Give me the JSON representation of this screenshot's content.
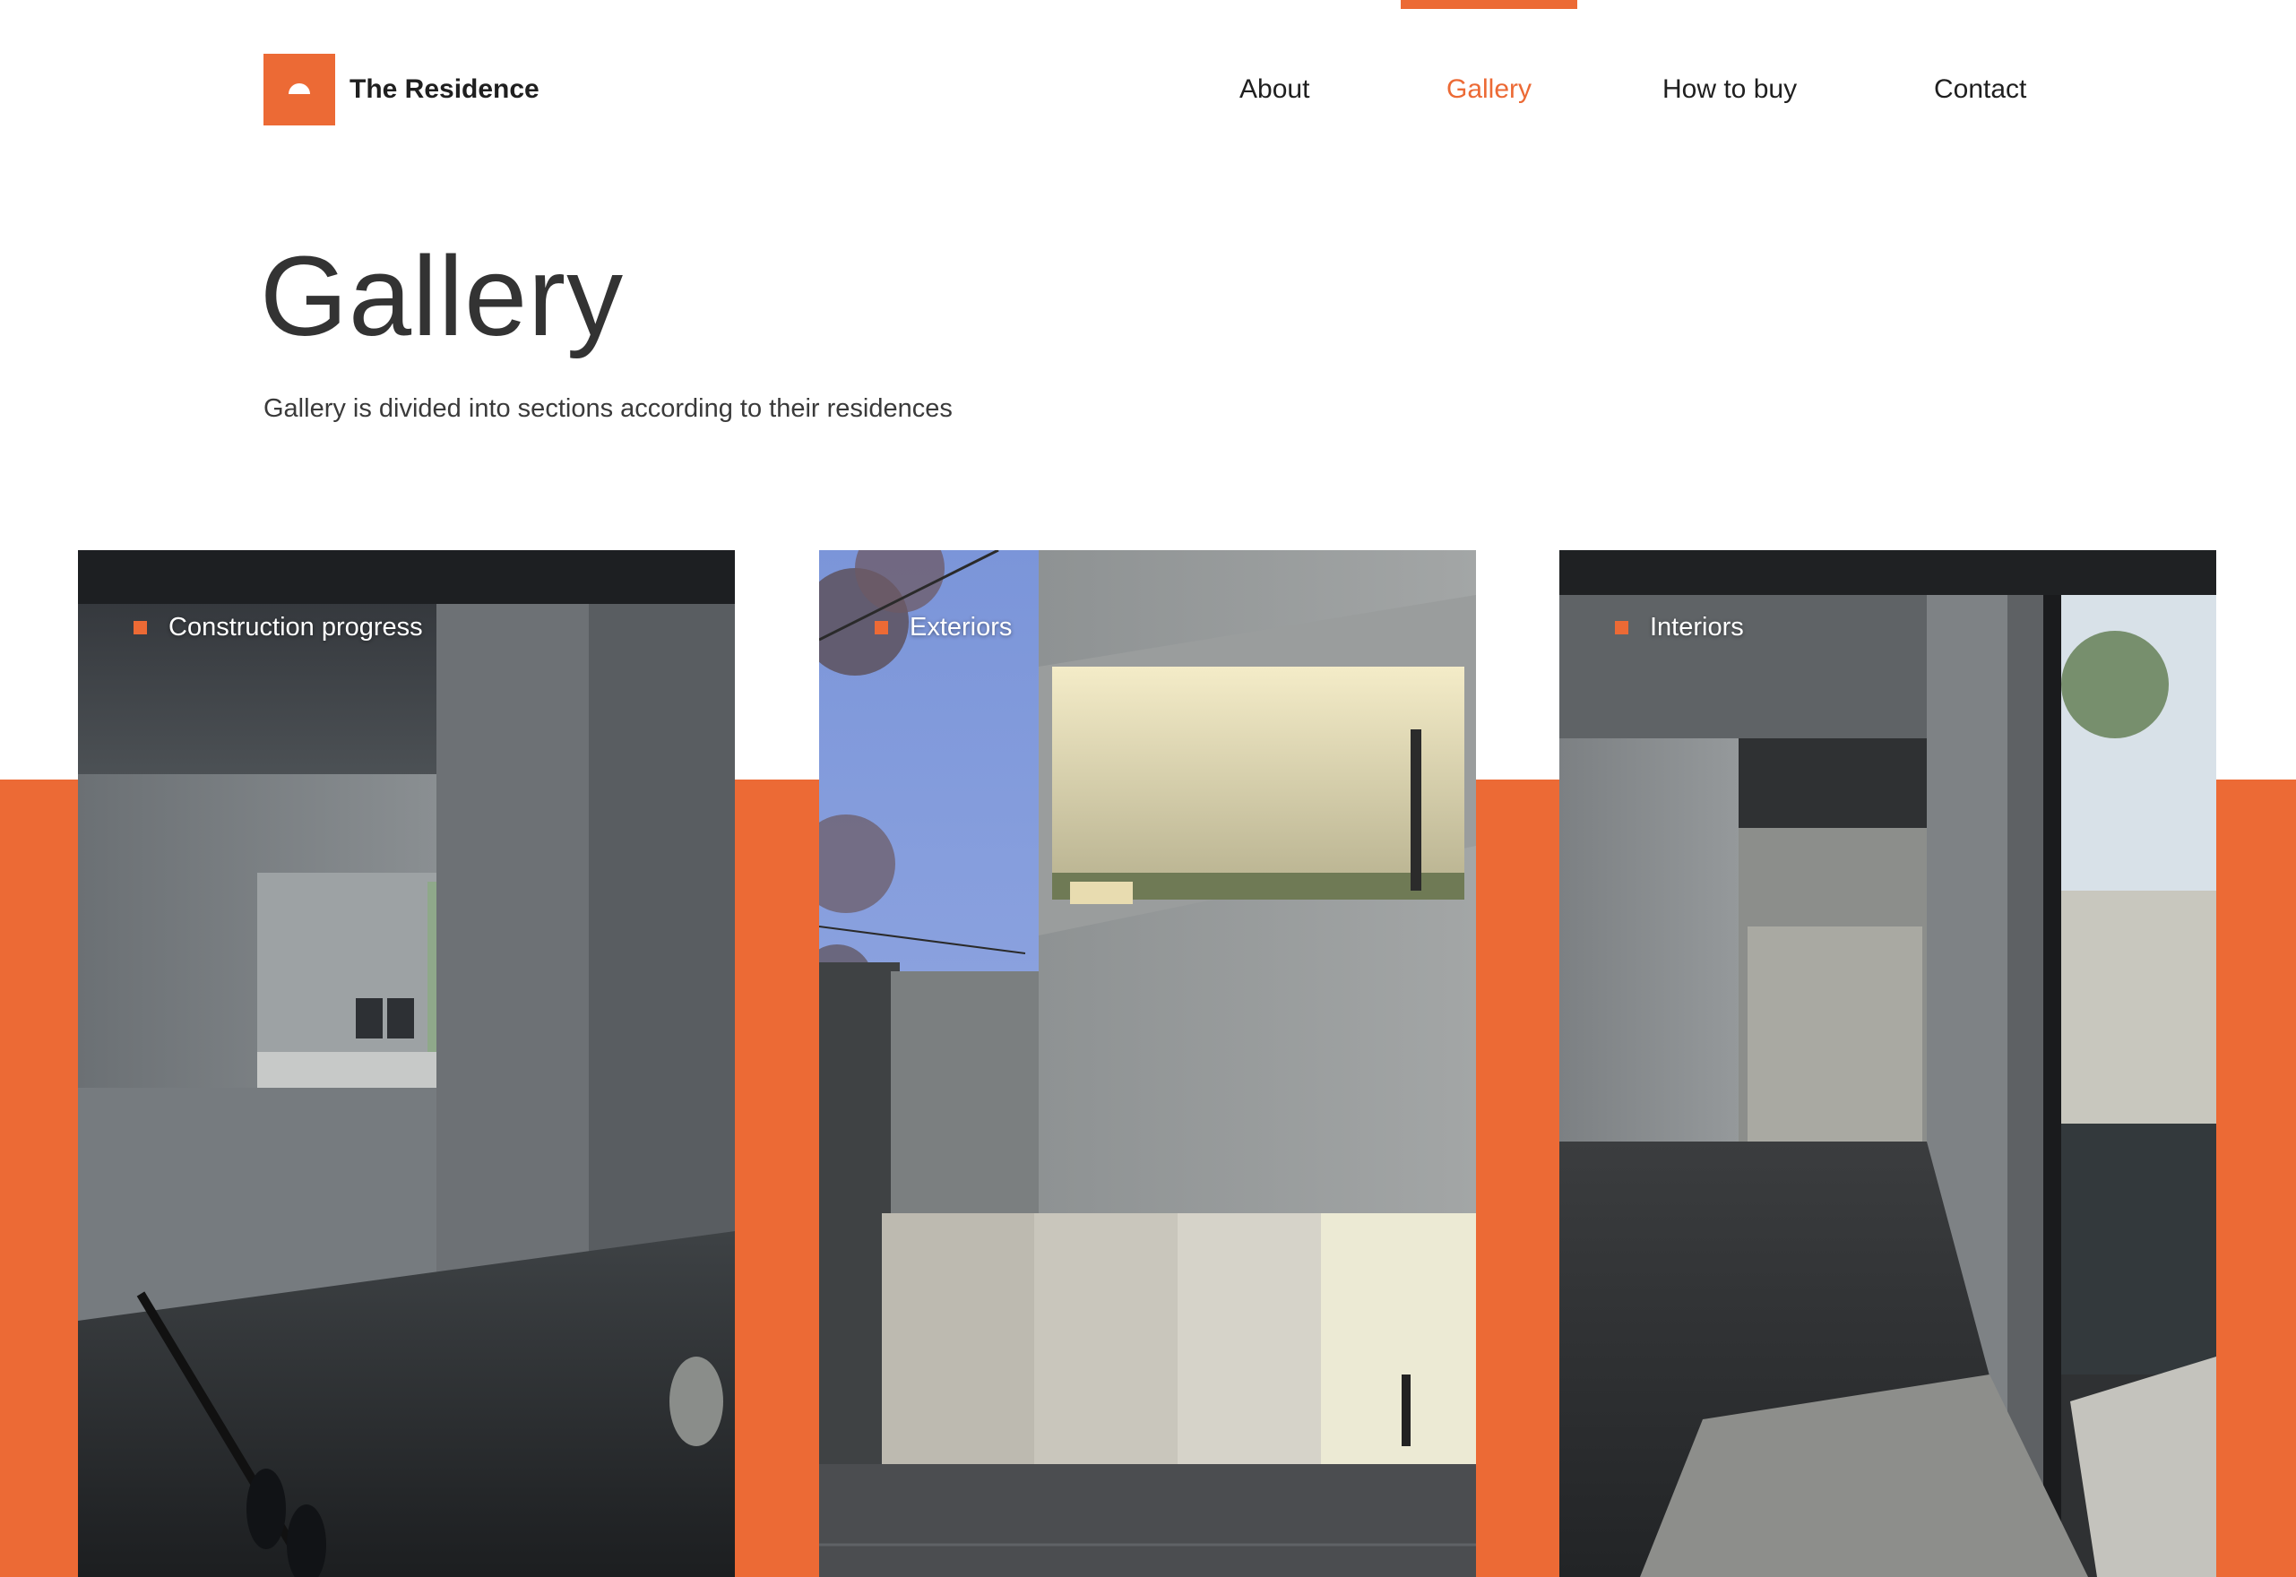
{
  "header": {
    "brand": "The Residence",
    "brand_color": "#ec6a35",
    "logo_icon": "half-sun-icon",
    "nav": [
      {
        "label": "About",
        "active": false
      },
      {
        "label": "Gallery",
        "active": true
      },
      {
        "label": "How to buy",
        "active": false
      },
      {
        "label": "Contact",
        "active": false
      }
    ]
  },
  "main": {
    "title": "Gallery",
    "subtitle": "Gallery is divided into sections according to their residences"
  },
  "gallery": {
    "cards": [
      {
        "label": "Construction progress",
        "photo": "concrete-interior-atrium-photo"
      },
      {
        "label": "Exteriors",
        "photo": "concrete-house-facade-dusk-photo"
      },
      {
        "label": "Interiors",
        "photo": "concrete-entrance-hall-stone-photo"
      }
    ]
  }
}
